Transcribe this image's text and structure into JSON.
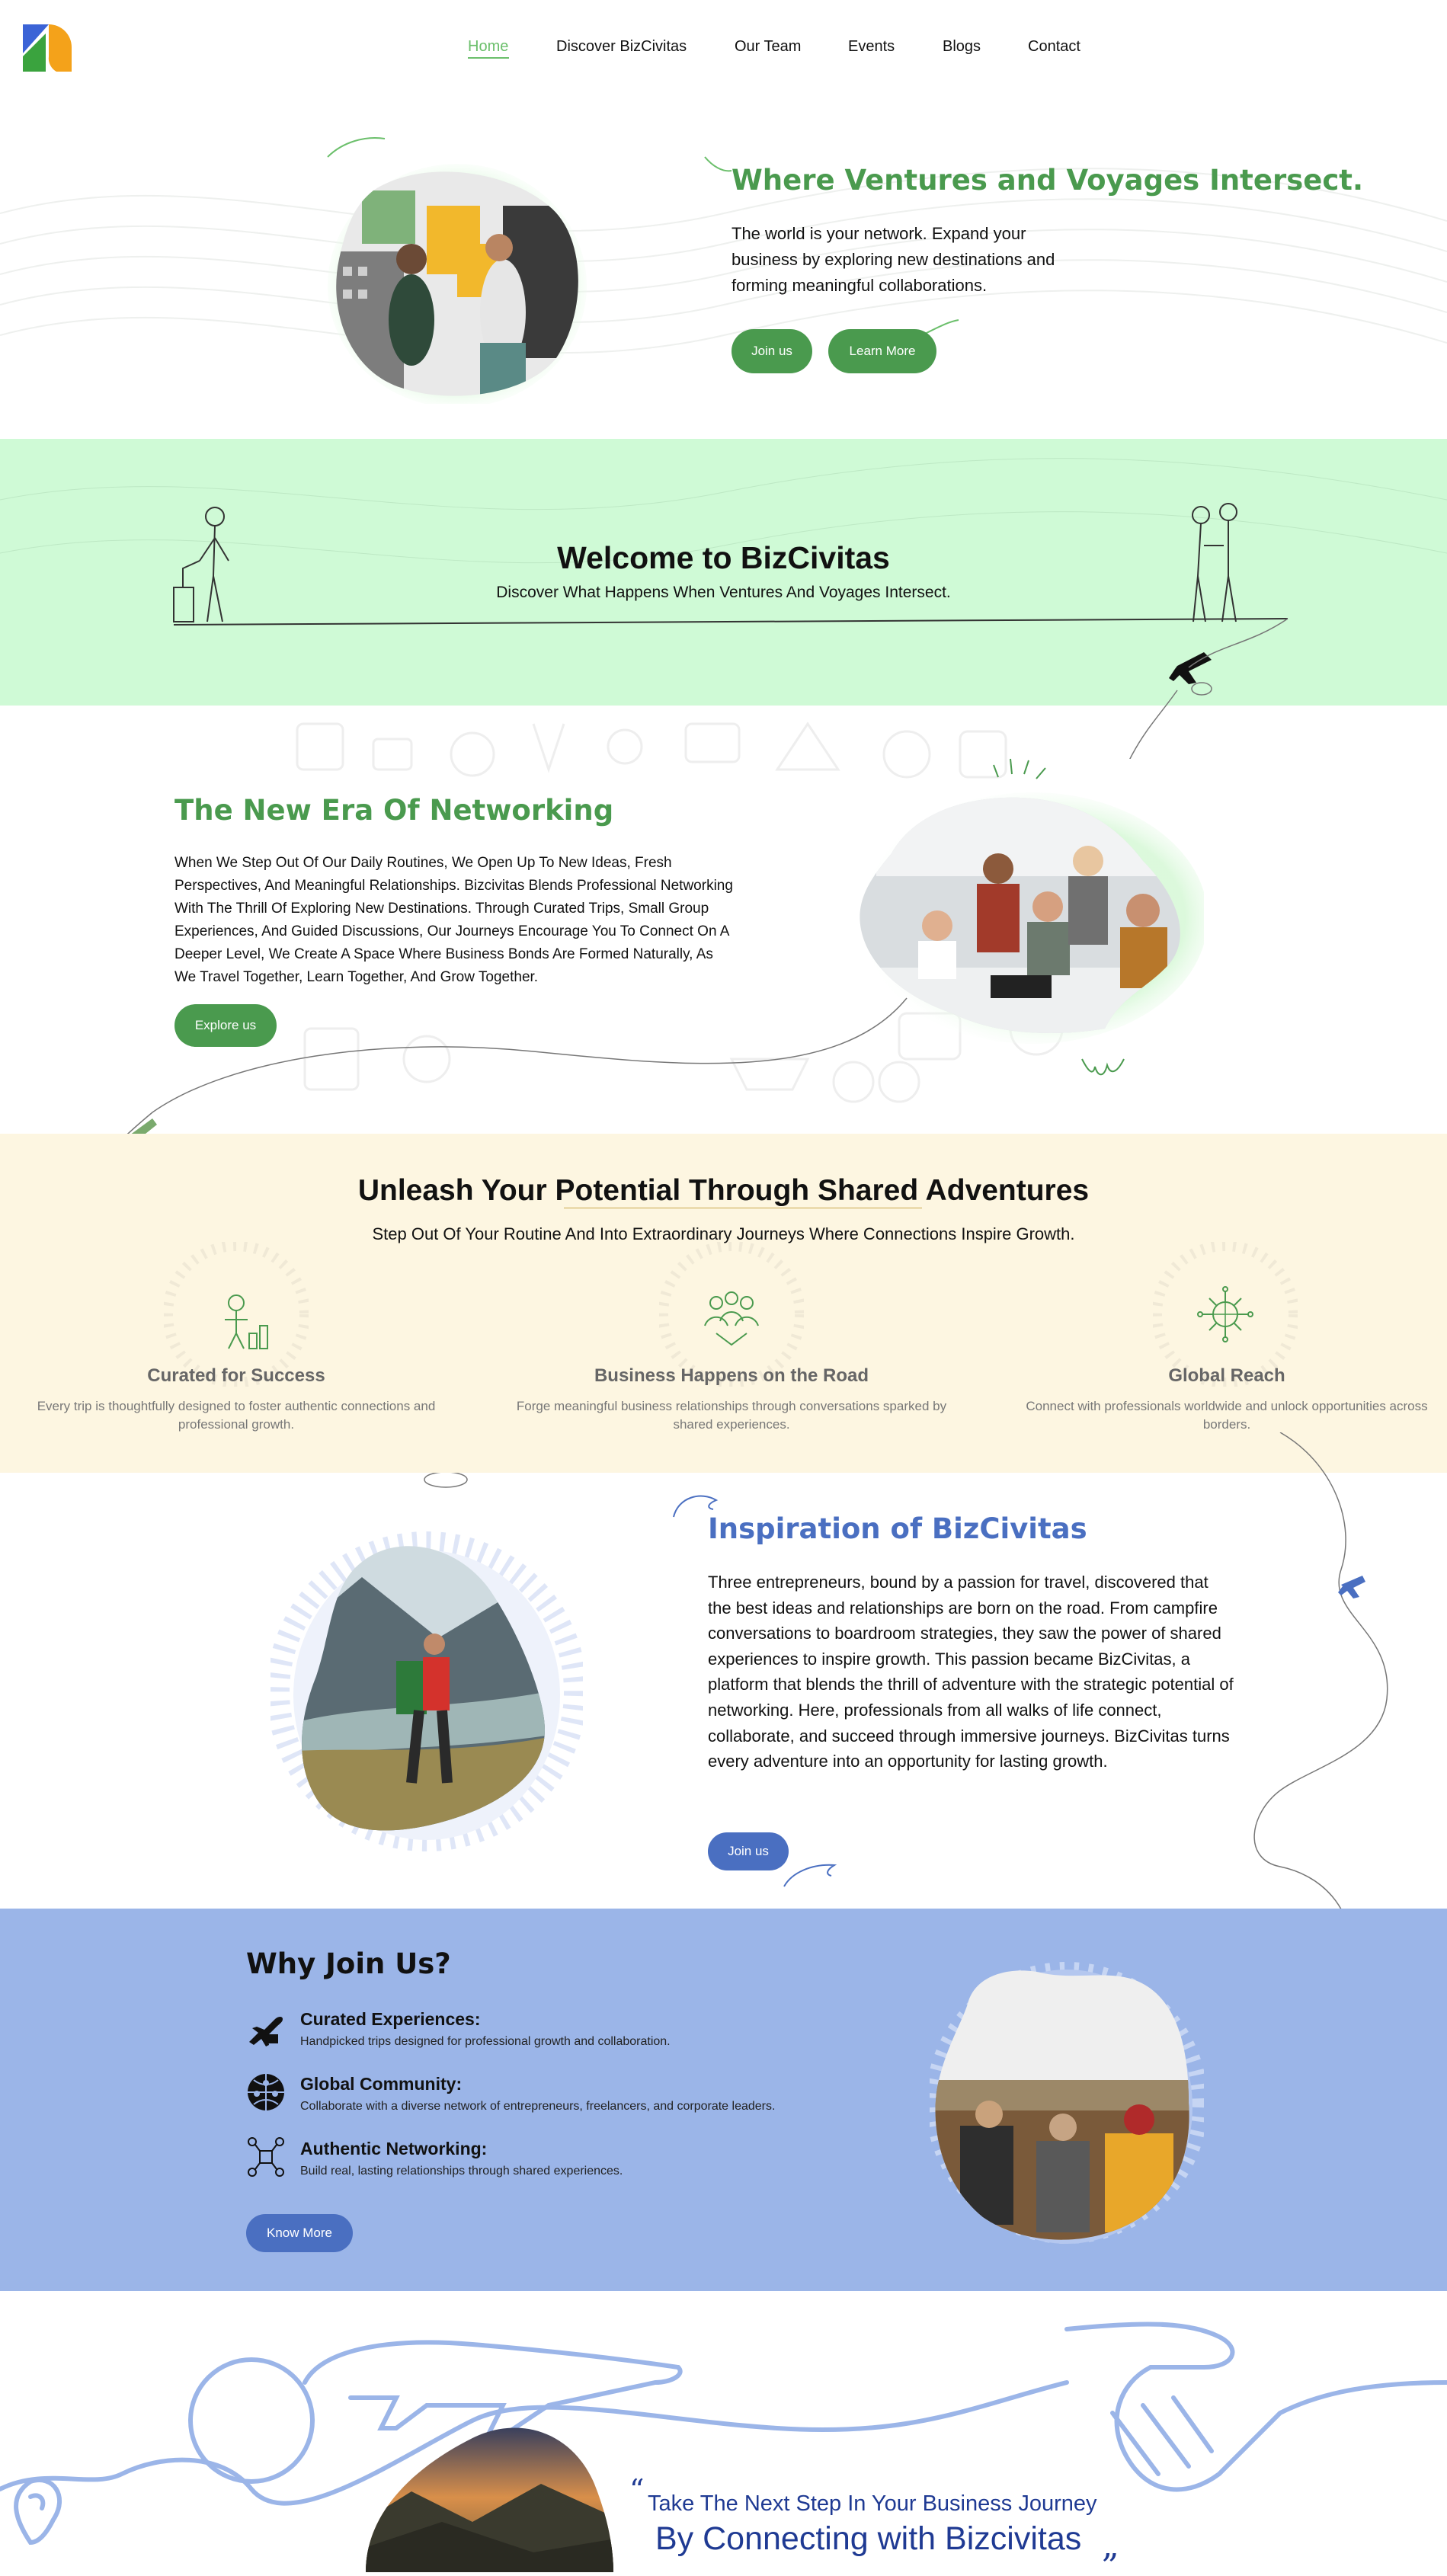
{
  "nav": {
    "logo": "logo",
    "items": [
      "Home",
      "Discover BizCivitas",
      "Our Team",
      "Events",
      "Blogs",
      "Contact"
    ],
    "active": "Home"
  },
  "hero": {
    "title": "Where Ventures and Voyages Intersect.",
    "body": "The world is your network. Expand your business by exploring new destinations and forming meaningful collaborations.",
    "join_label": "Join us",
    "learn_label": "Learn More"
  },
  "welcome": {
    "title": "Welcome to BizCivitas",
    "subtitle": "Discover What Happens When Ventures And Voyages Intersect."
  },
  "networking": {
    "title": "The New Era Of Networking",
    "body": "When We Step Out Of Our Daily Routines, We Open Up To New Ideas, Fresh Perspectives, And Meaningful Relationships. Bizcivitas Blends Professional Networking With The Thrill Of Exploring New Destinations. Through Curated Trips, Small Group Experiences, And Guided Discussions, Our Journeys Encourage You To Connect On A Deeper Level, We Create A Space Where Business Bonds Are Formed Naturally, As We Travel Together, Learn Together, And Grow Together.",
    "button_label": "Explore us"
  },
  "unleash": {
    "title": "Unleash Your Potential Through Shared Adventures",
    "subtitle": "Step Out Of Your Routine And Into Extraordinary Journeys Where Connections Inspire Growth.",
    "features": [
      {
        "icon": "success-icon",
        "title": "Curated for Success",
        "desc": "Every trip is thoughtfully designed to foster authentic connections and professional growth."
      },
      {
        "icon": "handshake-group-icon",
        "title": "Business Happens on the Road",
        "desc": "Forge meaningful business relationships through conversations sparked by shared experiences."
      },
      {
        "icon": "globe-network-icon",
        "title": "Global Reach",
        "desc": "Connect with professionals worldwide and unlock opportunities across borders."
      }
    ]
  },
  "inspiration": {
    "title": "Inspiration of BizCivitas",
    "body": "Three entrepreneurs, bound by a passion for travel, discovered that the best ideas and relationships are born on the road. From campfire conversations to boardroom strategies, they saw the power of shared experiences to inspire growth. This passion became BizCivitas, a platform that blends the thrill of adventure with the strategic potential of networking. Here, professionals from all walks of life connect, collaborate, and succeed through immersive journeys. BizCivitas turns every adventure into an opportunity for lasting growth.",
    "button_label": "Join us"
  },
  "why": {
    "title": "Why Join Us?",
    "items": [
      {
        "icon": "airplane-icon",
        "title": "Curated Experiences:",
        "desc": "Handpicked trips designed for professional growth and collaboration."
      },
      {
        "icon": "globe-people-icon",
        "title": "Global Community:",
        "desc": "Collaborate with a diverse network of entrepreneurs, freelancers, and corporate leaders."
      },
      {
        "icon": "network-icon",
        "title": "Authentic Networking:",
        "desc": "Build real, lasting relationships through shared experiences."
      }
    ],
    "button_label": "Know More"
  },
  "quote": {
    "open": "“",
    "line1": "Take The Next Step In Your Business Journey",
    "line2": "By Connecting with Bizcivitas",
    "close": "„"
  },
  "colors": {
    "green": "#4a9a4e",
    "nav_active": "#6bbf6b",
    "welcome_bg": "#cffad6",
    "unleash_bg": "#fdf6e1",
    "why_bg": "#9bb5e8",
    "blue": "#4a6fc1",
    "quote_blue": "#1f3a93"
  }
}
